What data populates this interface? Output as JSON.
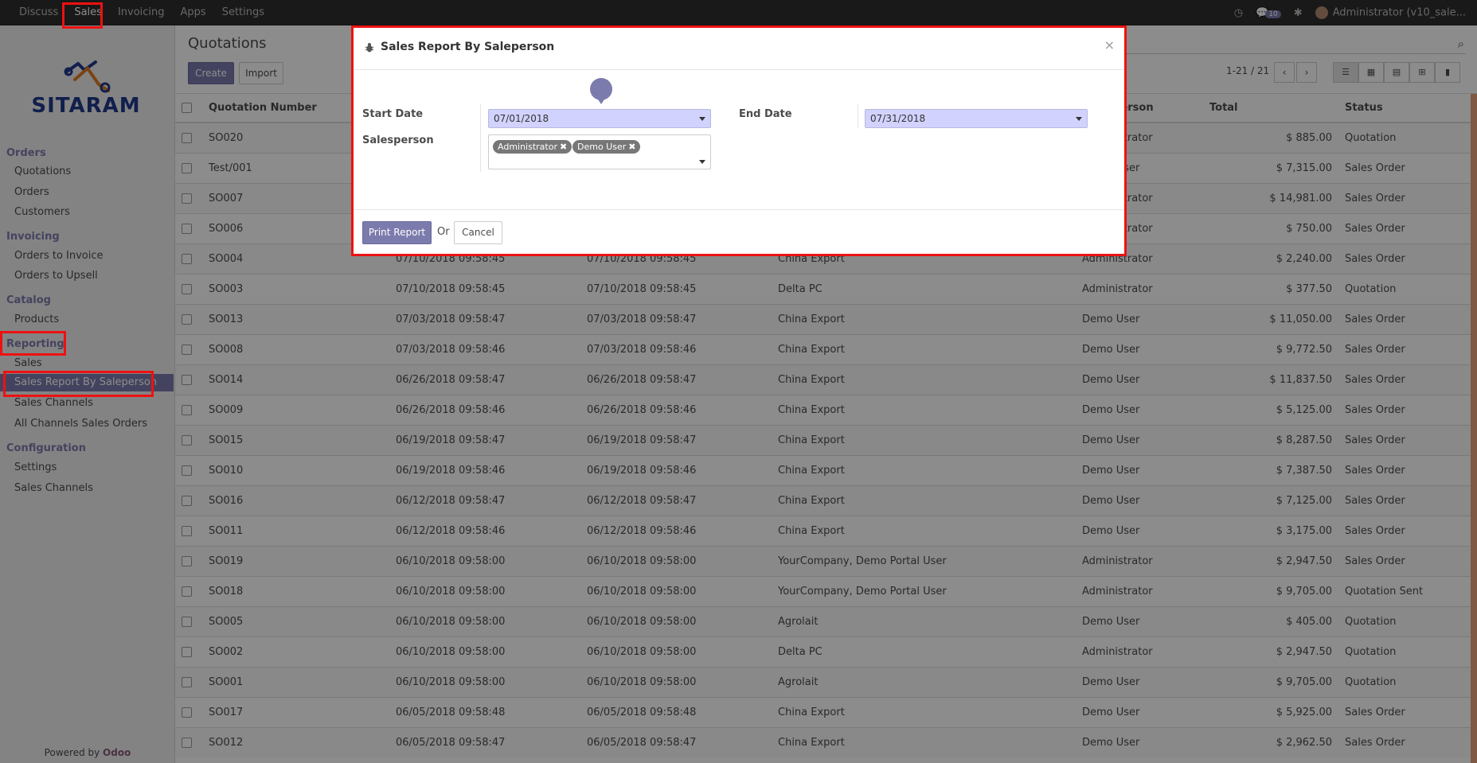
{
  "topbar": {
    "menu": [
      "Discuss",
      "Sales",
      "Invoicing",
      "Apps",
      "Settings"
    ],
    "active": "Sales",
    "messages_badge": "10",
    "user": "Administrator (v10_sale..."
  },
  "sidebar": {
    "logo": "SITARAM",
    "groups": {
      "orders": "Orders",
      "invoicing": "Invoicing",
      "catalog": "Catalog",
      "reporting": "Reporting",
      "configuration": "Configuration"
    },
    "items": {
      "quotations": "Quotations",
      "orders": "Orders",
      "customers": "Customers",
      "orders_to_invoice": "Orders to Invoice",
      "orders_to_upsell": "Orders to Upsell",
      "products": "Products",
      "sales": "Sales",
      "sales_report": "Sales Report By Saleperson",
      "sales_channels": "Sales Channels",
      "all_channels": "All Channels Sales Orders",
      "settings": "Settings",
      "sales_channels_2": "Sales Channels"
    },
    "powered_prefix": "Powered by ",
    "powered_brand": "Odoo"
  },
  "control": {
    "breadcrumb": "Quotations",
    "create": "Create",
    "import": "Import",
    "pager": "1-21 / 21"
  },
  "table": {
    "headers": {
      "number": "Quotation Number",
      "salesperson": "Salesperson",
      "total": "Total",
      "status": "Status"
    },
    "rows": [
      [
        "SO020",
        "",
        "",
        "",
        "Administrator",
        "$ 885.00",
        "Quotation"
      ],
      [
        "Test/001",
        "",
        "",
        "",
        "Demo User",
        "$ 7,315.00",
        "Sales Order"
      ],
      [
        "SO007",
        "",
        "",
        "",
        "Administrator",
        "$ 14,981.00",
        "Sales Order"
      ],
      [
        "SO006",
        "",
        "",
        "",
        "Administrator",
        "$ 750.00",
        "Sales Order"
      ],
      [
        "SO004",
        "07/10/2018 09:58:45",
        "07/10/2018 09:58:45",
        "China Export",
        "Administrator",
        "$ 2,240.00",
        "Sales Order"
      ],
      [
        "SO003",
        "07/10/2018 09:58:45",
        "07/10/2018 09:58:45",
        "Delta PC",
        "Administrator",
        "$ 377.50",
        "Quotation"
      ],
      [
        "SO013",
        "07/03/2018 09:58:47",
        "07/03/2018 09:58:47",
        "China Export",
        "Demo User",
        "$ 11,050.00",
        "Sales Order"
      ],
      [
        "SO008",
        "07/03/2018 09:58:46",
        "07/03/2018 09:58:46",
        "China Export",
        "Demo User",
        "$ 9,772.50",
        "Sales Order"
      ],
      [
        "SO014",
        "06/26/2018 09:58:47",
        "06/26/2018 09:58:47",
        "China Export",
        "Demo User",
        "$ 11,837.50",
        "Sales Order"
      ],
      [
        "SO009",
        "06/26/2018 09:58:46",
        "06/26/2018 09:58:46",
        "China Export",
        "Demo User",
        "$ 5,125.00",
        "Sales Order"
      ],
      [
        "SO015",
        "06/19/2018 09:58:47",
        "06/19/2018 09:58:47",
        "China Export",
        "Demo User",
        "$ 8,287.50",
        "Sales Order"
      ],
      [
        "SO010",
        "06/19/2018 09:58:46",
        "06/19/2018 09:58:46",
        "China Export",
        "Demo User",
        "$ 7,387.50",
        "Sales Order"
      ],
      [
        "SO016",
        "06/12/2018 09:58:47",
        "06/12/2018 09:58:47",
        "China Export",
        "Demo User",
        "$ 7,125.00",
        "Sales Order"
      ],
      [
        "SO011",
        "06/12/2018 09:58:46",
        "06/12/2018 09:58:46",
        "China Export",
        "Demo User",
        "$ 3,175.00",
        "Sales Order"
      ],
      [
        "SO019",
        "06/10/2018 09:58:00",
        "06/10/2018 09:58:00",
        "YourCompany, Demo Portal User",
        "Administrator",
        "$ 2,947.50",
        "Sales Order"
      ],
      [
        "SO018",
        "06/10/2018 09:58:00",
        "06/10/2018 09:58:00",
        "YourCompany, Demo Portal User",
        "Administrator",
        "$ 9,705.00",
        "Quotation Sent"
      ],
      [
        "SO005",
        "06/10/2018 09:58:00",
        "06/10/2018 09:58:00",
        "Agrolait",
        "Demo User",
        "$ 405.00",
        "Quotation"
      ],
      [
        "SO002",
        "06/10/2018 09:58:00",
        "06/10/2018 09:58:00",
        "Delta PC",
        "Administrator",
        "$ 2,947.50",
        "Quotation"
      ],
      [
        "SO001",
        "06/10/2018 09:58:00",
        "06/10/2018 09:58:00",
        "Agrolait",
        "Demo User",
        "$ 9,705.00",
        "Quotation"
      ],
      [
        "SO017",
        "06/05/2018 09:58:48",
        "06/05/2018 09:58:48",
        "China Export",
        "Demo User",
        "$ 5,925.00",
        "Sales Order"
      ],
      [
        "SO012",
        "06/05/2018 09:58:47",
        "06/05/2018 09:58:47",
        "China Export",
        "Demo User",
        "$ 2,962.50",
        "Sales Order"
      ]
    ]
  },
  "modal": {
    "title": "Sales Report By Saleperson",
    "close": "×",
    "start_date_label": "Start Date",
    "start_date": "07/01/2018",
    "end_date_label": "End Date",
    "end_date": "07/31/2018",
    "salesperson_label": "Salesperson",
    "tags": [
      "Administrator",
      "Demo User"
    ],
    "tag_remove": "✖",
    "print": "Print Report",
    "or": "Or",
    "cancel": "Cancel"
  },
  "colors": {
    "brand": "#7c7bad",
    "highlight": "#ee1111"
  }
}
